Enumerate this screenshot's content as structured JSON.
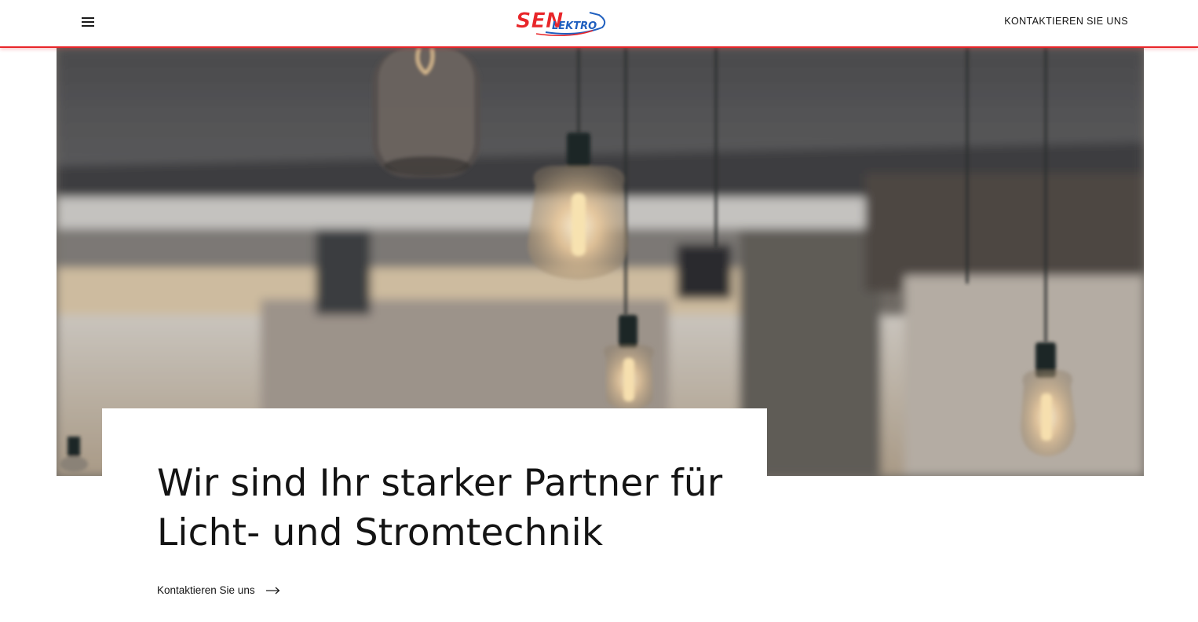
{
  "header": {
    "menu_icon": "hamburger-menu-icon",
    "logo": {
      "text_primary": "SEN",
      "text_secondary": "LEKTRO",
      "colors": {
        "primary": "#e8262a",
        "secondary": "#1f5fbf"
      }
    },
    "cta_label": "KONTAKTIEREN SIE UNS"
  },
  "hero": {
    "image_description_icon": "pendant-lamps-photo",
    "title_line1": "Wir sind Ihr starker Partner für",
    "title_line2": "Licht- und Stromtechnik",
    "link_label": "Kontaktieren Sie uns",
    "link_icon": "arrow-right-icon"
  },
  "colors": {
    "accent": "#e8262a",
    "text": "#141414",
    "background": "#ffffff"
  }
}
